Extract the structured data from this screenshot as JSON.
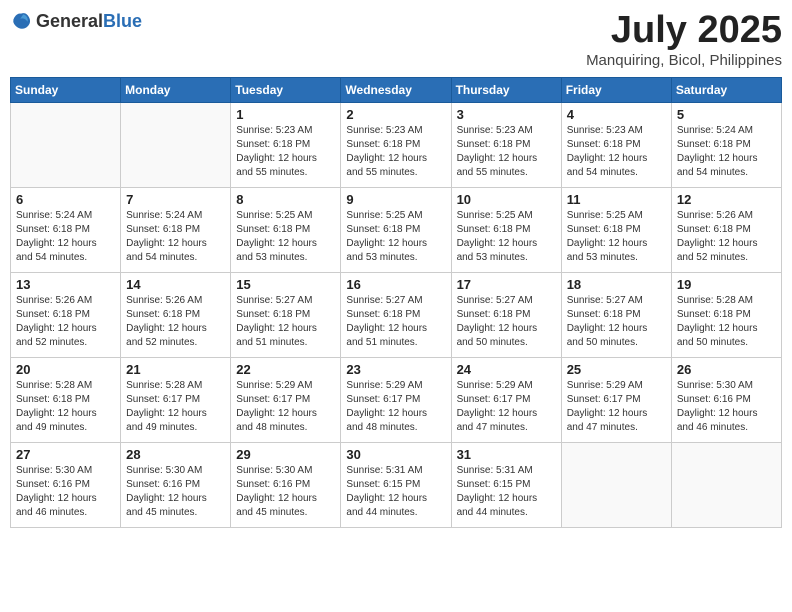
{
  "header": {
    "logo_general": "General",
    "logo_blue": "Blue",
    "title": "July 2025",
    "location": "Manquiring, Bicol, Philippines"
  },
  "days_of_week": [
    "Sunday",
    "Monday",
    "Tuesday",
    "Wednesday",
    "Thursday",
    "Friday",
    "Saturday"
  ],
  "weeks": [
    [
      {
        "day": "",
        "sunrise": "",
        "sunset": "",
        "daylight": ""
      },
      {
        "day": "",
        "sunrise": "",
        "sunset": "",
        "daylight": ""
      },
      {
        "day": "1",
        "sunrise": "Sunrise: 5:23 AM",
        "sunset": "Sunset: 6:18 PM",
        "daylight": "Daylight: 12 hours and 55 minutes."
      },
      {
        "day": "2",
        "sunrise": "Sunrise: 5:23 AM",
        "sunset": "Sunset: 6:18 PM",
        "daylight": "Daylight: 12 hours and 55 minutes."
      },
      {
        "day": "3",
        "sunrise": "Sunrise: 5:23 AM",
        "sunset": "Sunset: 6:18 PM",
        "daylight": "Daylight: 12 hours and 55 minutes."
      },
      {
        "day": "4",
        "sunrise": "Sunrise: 5:23 AM",
        "sunset": "Sunset: 6:18 PM",
        "daylight": "Daylight: 12 hours and 54 minutes."
      },
      {
        "day": "5",
        "sunrise": "Sunrise: 5:24 AM",
        "sunset": "Sunset: 6:18 PM",
        "daylight": "Daylight: 12 hours and 54 minutes."
      }
    ],
    [
      {
        "day": "6",
        "sunrise": "Sunrise: 5:24 AM",
        "sunset": "Sunset: 6:18 PM",
        "daylight": "Daylight: 12 hours and 54 minutes."
      },
      {
        "day": "7",
        "sunrise": "Sunrise: 5:24 AM",
        "sunset": "Sunset: 6:18 PM",
        "daylight": "Daylight: 12 hours and 54 minutes."
      },
      {
        "day": "8",
        "sunrise": "Sunrise: 5:25 AM",
        "sunset": "Sunset: 6:18 PM",
        "daylight": "Daylight: 12 hours and 53 minutes."
      },
      {
        "day": "9",
        "sunrise": "Sunrise: 5:25 AM",
        "sunset": "Sunset: 6:18 PM",
        "daylight": "Daylight: 12 hours and 53 minutes."
      },
      {
        "day": "10",
        "sunrise": "Sunrise: 5:25 AM",
        "sunset": "Sunset: 6:18 PM",
        "daylight": "Daylight: 12 hours and 53 minutes."
      },
      {
        "day": "11",
        "sunrise": "Sunrise: 5:25 AM",
        "sunset": "Sunset: 6:18 PM",
        "daylight": "Daylight: 12 hours and 53 minutes."
      },
      {
        "day": "12",
        "sunrise": "Sunrise: 5:26 AM",
        "sunset": "Sunset: 6:18 PM",
        "daylight": "Daylight: 12 hours and 52 minutes."
      }
    ],
    [
      {
        "day": "13",
        "sunrise": "Sunrise: 5:26 AM",
        "sunset": "Sunset: 6:18 PM",
        "daylight": "Daylight: 12 hours and 52 minutes."
      },
      {
        "day": "14",
        "sunrise": "Sunrise: 5:26 AM",
        "sunset": "Sunset: 6:18 PM",
        "daylight": "Daylight: 12 hours and 52 minutes."
      },
      {
        "day": "15",
        "sunrise": "Sunrise: 5:27 AM",
        "sunset": "Sunset: 6:18 PM",
        "daylight": "Daylight: 12 hours and 51 minutes."
      },
      {
        "day": "16",
        "sunrise": "Sunrise: 5:27 AM",
        "sunset": "Sunset: 6:18 PM",
        "daylight": "Daylight: 12 hours and 51 minutes."
      },
      {
        "day": "17",
        "sunrise": "Sunrise: 5:27 AM",
        "sunset": "Sunset: 6:18 PM",
        "daylight": "Daylight: 12 hours and 50 minutes."
      },
      {
        "day": "18",
        "sunrise": "Sunrise: 5:27 AM",
        "sunset": "Sunset: 6:18 PM",
        "daylight": "Daylight: 12 hours and 50 minutes."
      },
      {
        "day": "19",
        "sunrise": "Sunrise: 5:28 AM",
        "sunset": "Sunset: 6:18 PM",
        "daylight": "Daylight: 12 hours and 50 minutes."
      }
    ],
    [
      {
        "day": "20",
        "sunrise": "Sunrise: 5:28 AM",
        "sunset": "Sunset: 6:18 PM",
        "daylight": "Daylight: 12 hours and 49 minutes."
      },
      {
        "day": "21",
        "sunrise": "Sunrise: 5:28 AM",
        "sunset": "Sunset: 6:17 PM",
        "daylight": "Daylight: 12 hours and 49 minutes."
      },
      {
        "day": "22",
        "sunrise": "Sunrise: 5:29 AM",
        "sunset": "Sunset: 6:17 PM",
        "daylight": "Daylight: 12 hours and 48 minutes."
      },
      {
        "day": "23",
        "sunrise": "Sunrise: 5:29 AM",
        "sunset": "Sunset: 6:17 PM",
        "daylight": "Daylight: 12 hours and 48 minutes."
      },
      {
        "day": "24",
        "sunrise": "Sunrise: 5:29 AM",
        "sunset": "Sunset: 6:17 PM",
        "daylight": "Daylight: 12 hours and 47 minutes."
      },
      {
        "day": "25",
        "sunrise": "Sunrise: 5:29 AM",
        "sunset": "Sunset: 6:17 PM",
        "daylight": "Daylight: 12 hours and 47 minutes."
      },
      {
        "day": "26",
        "sunrise": "Sunrise: 5:30 AM",
        "sunset": "Sunset: 6:16 PM",
        "daylight": "Daylight: 12 hours and 46 minutes."
      }
    ],
    [
      {
        "day": "27",
        "sunrise": "Sunrise: 5:30 AM",
        "sunset": "Sunset: 6:16 PM",
        "daylight": "Daylight: 12 hours and 46 minutes."
      },
      {
        "day": "28",
        "sunrise": "Sunrise: 5:30 AM",
        "sunset": "Sunset: 6:16 PM",
        "daylight": "Daylight: 12 hours and 45 minutes."
      },
      {
        "day": "29",
        "sunrise": "Sunrise: 5:30 AM",
        "sunset": "Sunset: 6:16 PM",
        "daylight": "Daylight: 12 hours and 45 minutes."
      },
      {
        "day": "30",
        "sunrise": "Sunrise: 5:31 AM",
        "sunset": "Sunset: 6:15 PM",
        "daylight": "Daylight: 12 hours and 44 minutes."
      },
      {
        "day": "31",
        "sunrise": "Sunrise: 5:31 AM",
        "sunset": "Sunset: 6:15 PM",
        "daylight": "Daylight: 12 hours and 44 minutes."
      },
      {
        "day": "",
        "sunrise": "",
        "sunset": "",
        "daylight": ""
      },
      {
        "day": "",
        "sunrise": "",
        "sunset": "",
        "daylight": ""
      }
    ]
  ]
}
